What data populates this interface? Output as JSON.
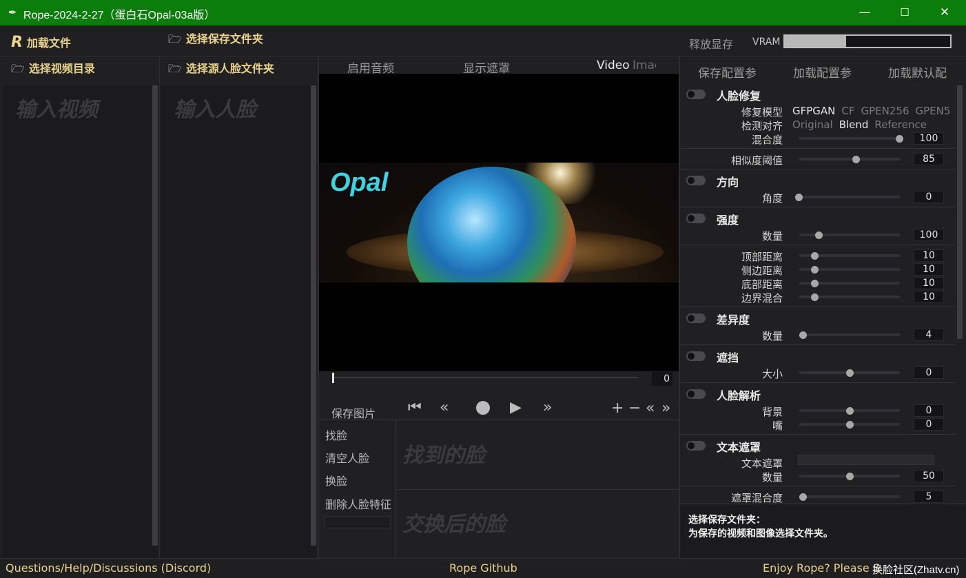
{
  "window": {
    "title": "Rope-2024-2-27（蛋白石Opal-03a版）",
    "minimize": "—",
    "maximize": "☐",
    "close": "✕"
  },
  "topbar": {
    "load_files": "加载文件",
    "select_save_folder": "选择保存文件夹",
    "release_memory": "释放显存",
    "vram_label": "VRAM",
    "vram_usage_fraction": 0.37
  },
  "left": {
    "video_dir_button": "选择视频目录",
    "video_placeholder": "输入视频",
    "face_dir_button": "选择源人脸文件夹",
    "face_placeholder": "输入人脸"
  },
  "center": {
    "tabs": [
      "启用音频",
      "显示遮罩"
    ],
    "mode_video": "Video",
    "mode_image": "Imag",
    "preview_brand": "Opal",
    "frame_number": "0",
    "save_image": "保存图片",
    "actions": {
      "find_faces": "找脸",
      "clear_faces": "清空人脸",
      "swap_faces": "换脸",
      "delete_embedding": "删除人脸特征"
    },
    "found_faces_placeholder": "找到的脸",
    "swapped_faces_placeholder": "交换后的脸"
  },
  "right": {
    "header_buttons": [
      "保存配置参",
      "加载配置参",
      "加载默认配"
    ],
    "face_restore": {
      "title": "人脸修复",
      "model_label": "修复模型",
      "models": [
        "GFPGAN",
        "CF",
        "GPEN256",
        "GPEN5"
      ],
      "align_label": "检测对齐",
      "aligns": [
        "Original",
        "Blend",
        "Reference"
      ],
      "blend_label": "混合度",
      "blend_value": "100"
    },
    "similarity": {
      "label": "相似度阈值",
      "value": "85"
    },
    "orientation": {
      "title": "方向",
      "label": "角度",
      "value": "0"
    },
    "strength": {
      "title": "强度",
      "label": "数量",
      "value": "100"
    },
    "borders": {
      "top_label": "顶部距离",
      "top_value": "10",
      "side_label": "侧边距离",
      "side_value": "10",
      "bottom_label": "底部距离",
      "bottom_value": "10",
      "blend_label": "边界混合",
      "blend_value": "10"
    },
    "difference": {
      "title": "差异度",
      "label": "数量",
      "value": "4"
    },
    "occluder": {
      "title": "遮挡",
      "label": "大小",
      "value": "0"
    },
    "face_parser": {
      "title": "人脸解析",
      "bg_label": "背景",
      "bg_value": "0",
      "mouth_label": "嘴",
      "mouth_value": "0"
    },
    "text_mask": {
      "title": "文本遮罩",
      "text_label": "文本遮罩",
      "text_value": "",
      "amount_label": "数量",
      "amount_value": "50"
    },
    "mask_blend": {
      "label": "遮罩混合度",
      "value": "5"
    },
    "info_title": "选择保存文件夹：",
    "info_body": "为保存的视频和图像选择文件夹。"
  },
  "footer": {
    "discord": "Questions/Help/Discussions (Discord)",
    "github": "Rope Github",
    "support": "Enjoy Rope? Please S",
    "watermark": "换脸社区(Zhatv.cn)"
  },
  "colors": {
    "titlebar": "#0a7d0a",
    "accent_text": "#e8d48c",
    "background": "#202023"
  }
}
